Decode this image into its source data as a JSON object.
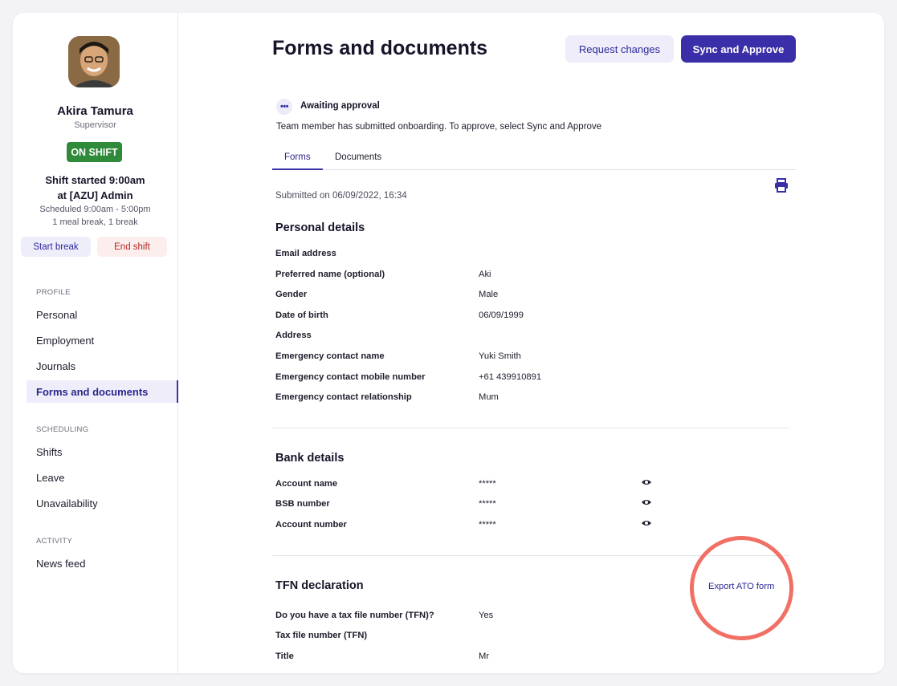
{
  "sidebar": {
    "name": "Akira Tamura",
    "role": "Supervisor",
    "status_badge": "ON SHIFT",
    "shift_started": "Shift started 9:00am",
    "shift_location": "at [AZU] Admin",
    "scheduled": "Scheduled 9:00am - 5:00pm",
    "breaks": "1 meal break, 1 break",
    "start_break": "Start break",
    "end_shift": "End shift",
    "sections": {
      "profile": "PROFILE",
      "scheduling": "SCHEDULING",
      "activity": "ACTIVITY"
    },
    "profile_items": [
      "Personal",
      "Employment",
      "Journals",
      "Forms and documents"
    ],
    "scheduling_items": [
      "Shifts",
      "Leave",
      "Unavailability"
    ],
    "activity_items": [
      "News feed"
    ]
  },
  "header": {
    "title": "Forms and documents",
    "request_changes": "Request changes",
    "sync_approve": "Sync and Approve"
  },
  "status": {
    "title": "Awaiting approval",
    "text": "Team member has submitted onboarding. To approve, select Sync and Approve"
  },
  "tabs": [
    "Forms",
    "Documents"
  ],
  "submitted": "Submitted on 06/09/2022, 16:34",
  "personal": {
    "title": "Personal details",
    "rows": [
      {
        "label": "Email address",
        "value": ""
      },
      {
        "label": "Preferred name (optional)",
        "value": "Aki"
      },
      {
        "label": "Gender",
        "value": "Male"
      },
      {
        "label": "Date of birth",
        "value": "06/09/1999"
      },
      {
        "label": "Address",
        "value": ""
      },
      {
        "label": "Emergency contact name",
        "value": "Yuki Smith"
      },
      {
        "label": "Emergency contact mobile number",
        "value": "+61 439910891"
      },
      {
        "label": "Emergency contact relationship",
        "value": "Mum"
      }
    ]
  },
  "bank": {
    "title": "Bank details",
    "rows": [
      {
        "label": "Account name",
        "value": "*****"
      },
      {
        "label": "BSB number",
        "value": "*****"
      },
      {
        "label": "Account number",
        "value": "*****"
      }
    ]
  },
  "tfn": {
    "title": "TFN declaration",
    "export": "Export ATO form",
    "rows": [
      {
        "label": "Do you have a tax file number (TFN)?",
        "value": "Yes"
      },
      {
        "label": "Tax file number (TFN)",
        "value": ""
      },
      {
        "label": "Title",
        "value": "Mr"
      }
    ]
  },
  "colors": {
    "accent": "#3a2fa8",
    "on_shift": "#2f8a3a",
    "highlight": "#f17066"
  }
}
